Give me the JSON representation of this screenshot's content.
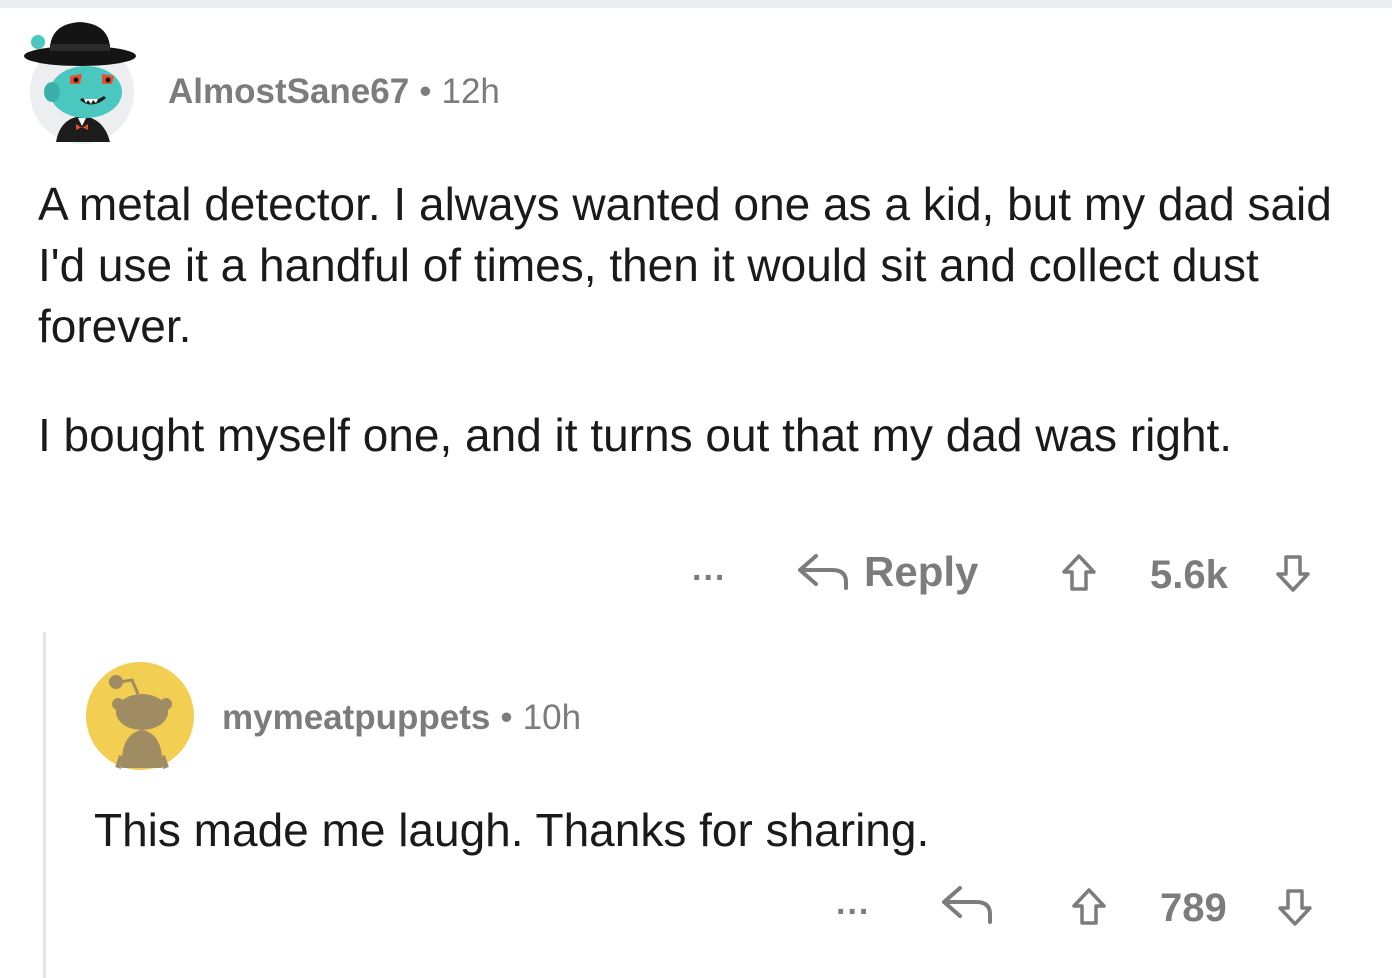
{
  "comments": [
    {
      "username": "AlmostSane67",
      "separator": "•",
      "time": "12h",
      "paragraphs": [
        "A metal detector.  I always wanted one as a kid, but my dad said I'd use it a handful of times, then it would sit and collect dust forever.",
        "I bought myself one, and it turns out that my dad was right."
      ],
      "actions": {
        "more": "...",
        "reply_label": "Reply",
        "score": "5.6k"
      },
      "icons": {
        "avatar": "snoo-avatar-fedora",
        "reply": "reply-arrow-icon",
        "upvote": "upvote-arrow-icon",
        "downvote": "downvote-arrow-icon"
      }
    },
    {
      "username": "mymeatpuppets",
      "separator": "•",
      "time": "10h",
      "paragraphs": [
        "This made me laugh. Thanks for sharing."
      ],
      "actions": {
        "more": "...",
        "score": "789"
      },
      "icons": {
        "avatar": "default-snoo-avatar",
        "reply": "reply-arrow-icon",
        "upvote": "upvote-arrow-icon",
        "downvote": "downvote-arrow-icon"
      }
    }
  ],
  "colors": {
    "meta_text": "#7c7c7c",
    "body_text": "#1a1a1b",
    "thread_line": "#e4e5e7",
    "avatar2_bg": "#f2cf52",
    "avatar1_bg": "#eceef0"
  }
}
